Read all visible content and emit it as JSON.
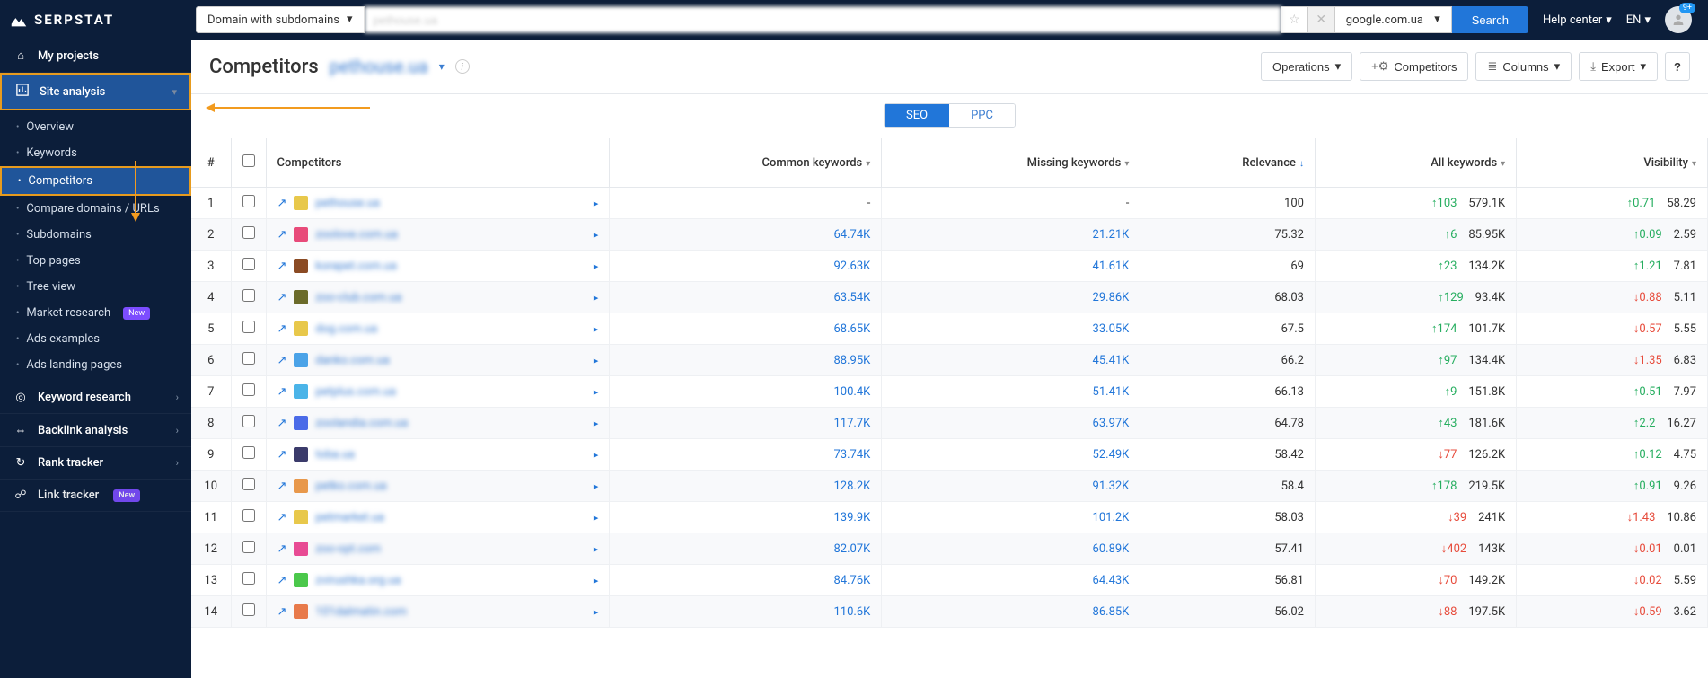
{
  "brand": "SERPSTAT",
  "topbar": {
    "domain_select": "Domain with subdomains",
    "search_value": "pethouse.ua",
    "engine": "google.com.ua",
    "search_button": "Search",
    "help": "Help center",
    "lang": "EN",
    "notif_count": "9+"
  },
  "sidebar": {
    "my_projects": "My projects",
    "site_analysis": "Site analysis",
    "sub": [
      {
        "label": "Overview"
      },
      {
        "label": "Keywords"
      },
      {
        "label": "Competitors"
      },
      {
        "label": "Compare domains / URLs"
      },
      {
        "label": "Subdomains"
      },
      {
        "label": "Top pages"
      },
      {
        "label": "Tree view"
      },
      {
        "label": "Market research",
        "badge": "New"
      },
      {
        "label": "Ads examples"
      },
      {
        "label": "Ads landing pages"
      }
    ],
    "keyword_research": "Keyword research",
    "backlink_analysis": "Backlink analysis",
    "rank_tracker": "Rank tracker",
    "link_tracker": "Link tracker",
    "new_badge": "New"
  },
  "page": {
    "title": "Competitors",
    "domain": "pethouse.ua",
    "toolbar": {
      "operations": "Operations",
      "competitors": "Competitors",
      "columns": "Columns",
      "export": "Export"
    },
    "tabs": {
      "seo": "SEO",
      "ppc": "PPC"
    }
  },
  "columns": {
    "num": "#",
    "competitors": "Competitors",
    "common": "Common keywords",
    "missing": "Missing keywords",
    "relevance": "Relevance",
    "all": "All keywords",
    "visibility": "Visibility"
  },
  "favcolors": [
    "#e8c84b",
    "#e84b7a",
    "#8b4b24",
    "#6b6b2a",
    "#e8c84b",
    "#4ba3e8",
    "#4bb4e8",
    "#4b6be8",
    "#3b3b6b",
    "#e8984b",
    "#e8c84b",
    "#e84b94",
    "#4bc84b",
    "#e87a4b"
  ],
  "rows": [
    {
      "n": 1,
      "name": "pethouse.ua",
      "common": "-",
      "missing": "-",
      "relevance": "100",
      "all_trend": "up",
      "all_delta": "103",
      "all": "579.1K",
      "vis_trend": "up",
      "vis_delta": "0.71",
      "vis": "58.29"
    },
    {
      "n": 2,
      "name": "zoolove.com.ua",
      "common": "64.74K",
      "missing": "21.21K",
      "relevance": "75.32",
      "all_trend": "up",
      "all_delta": "6",
      "all": "85.95K",
      "vis_trend": "up",
      "vis_delta": "0.09",
      "vis": "2.59"
    },
    {
      "n": 3,
      "name": "korapet.com.ua",
      "common": "92.63K",
      "missing": "41.61K",
      "relevance": "69",
      "all_trend": "up",
      "all_delta": "23",
      "all": "134.2K",
      "vis_trend": "up",
      "vis_delta": "1.21",
      "vis": "7.81"
    },
    {
      "n": 4,
      "name": "zoo-club.com.ua",
      "common": "63.54K",
      "missing": "29.86K",
      "relevance": "68.03",
      "all_trend": "up",
      "all_delta": "129",
      "all": "93.4K",
      "vis_trend": "down",
      "vis_delta": "0.88",
      "vis": "5.11"
    },
    {
      "n": 5,
      "name": "dog.com.ua",
      "common": "68.65K",
      "missing": "33.05K",
      "relevance": "67.5",
      "all_trend": "up",
      "all_delta": "174",
      "all": "101.7K",
      "vis_trend": "down",
      "vis_delta": "0.57",
      "vis": "5.55"
    },
    {
      "n": 6,
      "name": "danko.com.ua",
      "common": "88.95K",
      "missing": "45.41K",
      "relevance": "66.2",
      "all_trend": "up",
      "all_delta": "97",
      "all": "134.4K",
      "vis_trend": "down",
      "vis_delta": "1.35",
      "vis": "6.83"
    },
    {
      "n": 7,
      "name": "petplus.com.ua",
      "common": "100.4K",
      "missing": "51.41K",
      "relevance": "66.13",
      "all_trend": "up",
      "all_delta": "9",
      "all": "151.8K",
      "vis_trend": "up",
      "vis_delta": "0.51",
      "vis": "7.97"
    },
    {
      "n": 8,
      "name": "zoolandia.com.ua",
      "common": "117.7K",
      "missing": "63.97K",
      "relevance": "64.78",
      "all_trend": "up",
      "all_delta": "43",
      "all": "181.6K",
      "vis_trend": "up",
      "vis_delta": "2.2",
      "vis": "16.27"
    },
    {
      "n": 9,
      "name": "toba.ua",
      "common": "73.74K",
      "missing": "52.49K",
      "relevance": "58.42",
      "all_trend": "down",
      "all_delta": "77",
      "all": "126.2K",
      "vis_trend": "up",
      "vis_delta": "0.12",
      "vis": "4.75"
    },
    {
      "n": 10,
      "name": "petko.com.ua",
      "common": "128.2K",
      "missing": "91.32K",
      "relevance": "58.4",
      "all_trend": "up",
      "all_delta": "178",
      "all": "219.5K",
      "vis_trend": "up",
      "vis_delta": "0.91",
      "vis": "9.26"
    },
    {
      "n": 11,
      "name": "petmarket.ua",
      "common": "139.9K",
      "missing": "101.2K",
      "relevance": "58.03",
      "all_trend": "down",
      "all_delta": "39",
      "all": "241K",
      "vis_trend": "down",
      "vis_delta": "1.43",
      "vis": "10.86"
    },
    {
      "n": 12,
      "name": "zoo-opt.com",
      "common": "82.07K",
      "missing": "60.89K",
      "relevance": "57.41",
      "all_trend": "down",
      "all_delta": "402",
      "all": "143K",
      "vis_trend": "down",
      "vis_delta": "0.01",
      "vis": "0.01"
    },
    {
      "n": 13,
      "name": "zvirushka.org.ua",
      "common": "84.76K",
      "missing": "64.43K",
      "relevance": "56.81",
      "all_trend": "down",
      "all_delta": "70",
      "all": "149.2K",
      "vis_trend": "down",
      "vis_delta": "0.02",
      "vis": "5.59"
    },
    {
      "n": 14,
      "name": "101dalmatin.com",
      "common": "110.6K",
      "missing": "86.85K",
      "relevance": "56.02",
      "all_trend": "down",
      "all_delta": "88",
      "all": "197.5K",
      "vis_trend": "down",
      "vis_delta": "0.59",
      "vis": "3.62"
    }
  ]
}
